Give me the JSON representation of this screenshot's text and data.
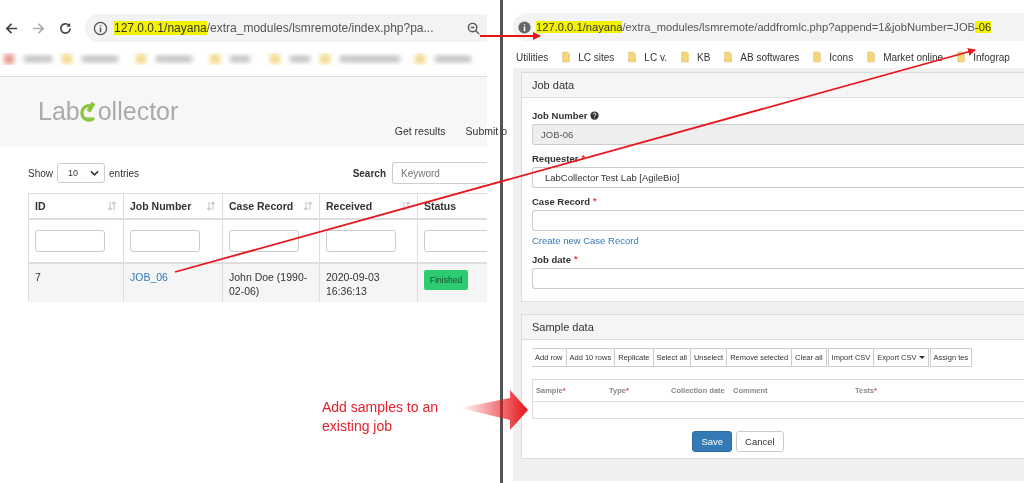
{
  "left_browser": {
    "url": [
      {
        "text": "127.0.0.1/nayana",
        "highlighted": true
      },
      {
        "text": "/extra_modules/lsmremote/index.php?pa...",
        "highlighted": false
      }
    ],
    "logo": {
      "before": "Lab",
      "after": "ollector"
    },
    "nav": [
      "Get results",
      "Submit o"
    ],
    "show": {
      "label": "Show",
      "value": "10",
      "suffix": "entries"
    },
    "search": {
      "label": "Search",
      "placeholder": "Keyword"
    },
    "table": {
      "columns": [
        {
          "label": "ID",
          "sortable": true
        },
        {
          "label": "Job Number",
          "sortable": true
        },
        {
          "label": "Case Record",
          "sortable": true
        },
        {
          "label": "Received",
          "sortable": true
        },
        {
          "label": "Status",
          "sortable": false
        }
      ],
      "rows": [
        {
          "id": "7",
          "job_number": "JOB_06",
          "case_record": "John Doe (1990-02-06)",
          "received": "2020-09-03 16:36:13",
          "status": "Finished"
        }
      ]
    }
  },
  "right_browser": {
    "url": [
      {
        "text": "127.0.0.1/nayana",
        "highlighted": true
      },
      {
        "text": "/extra_modules/lsmremote/addfromlc.php?append=1&jobNumber=JOB",
        "highlighted": false
      },
      {
        "text": "-06",
        "highlighted": true
      }
    ],
    "bookmarks": [
      {
        "label": "Utilities",
        "kind": "link"
      },
      {
        "label": "LC sites",
        "kind": "folder"
      },
      {
        "label": "LC v.",
        "kind": "folder"
      },
      {
        "label": "KB",
        "kind": "folder"
      },
      {
        "label": "AB softwares",
        "kind": "folder"
      },
      {
        "label": "Icons",
        "kind": "folder"
      },
      {
        "label": "Market online",
        "kind": "folder"
      },
      {
        "label": "Infograp",
        "kind": "folder"
      }
    ],
    "job_panel": {
      "title": "Job data",
      "fields": [
        {
          "label": "Job Number",
          "help": true,
          "value": "JOB-06",
          "disabled": true
        },
        {
          "label": "Requester",
          "help": false,
          "mark": "*",
          "value": "LabCollector Test Lab [AgileBio]",
          "disabled": false
        },
        {
          "label": "Case Record",
          "help": false,
          "mark": "*",
          "disabled": false,
          "link": "Create new Case Record"
        },
        {
          "label": "Job date",
          "help": false,
          "mark": "*",
          "disabled": false
        }
      ]
    },
    "sample_panel": {
      "title": "Sample data",
      "toolbar": [
        [
          {
            "label": "Add row",
            "kind": "plain"
          },
          {
            "label": "Add 10 rows",
            "kind": "plain"
          },
          {
            "label": "Replicate",
            "kind": "plain"
          },
          {
            "label": "Select all",
            "kind": "plain"
          },
          {
            "label": "Unselect",
            "kind": "plain"
          },
          {
            "label": "Remove selected",
            "kind": "plain"
          },
          {
            "label": "Clear all",
            "kind": "plain"
          }
        ],
        [
          {
            "label": "Import CSV",
            "kind": "plain"
          },
          {
            "label": "Export CSV",
            "kind": "dropdown"
          }
        ],
        [
          {
            "label": "Assign tes",
            "kind": "plain"
          }
        ]
      ],
      "columns": [
        {
          "label": "Sample",
          "mark": "*"
        },
        {
          "label": "Type",
          "mark": "*"
        },
        {
          "label": "Collection date"
        },
        {
          "label": "Comment"
        },
        {
          "label": "Tests",
          "mark": "*"
        }
      ],
      "buttons": [
        {
          "label": "Save",
          "kind": "primary"
        },
        {
          "label": "Cancel",
          "kind": "default"
        }
      ]
    }
  },
  "annotation": {
    "text": "Add samples to an existing job"
  }
}
